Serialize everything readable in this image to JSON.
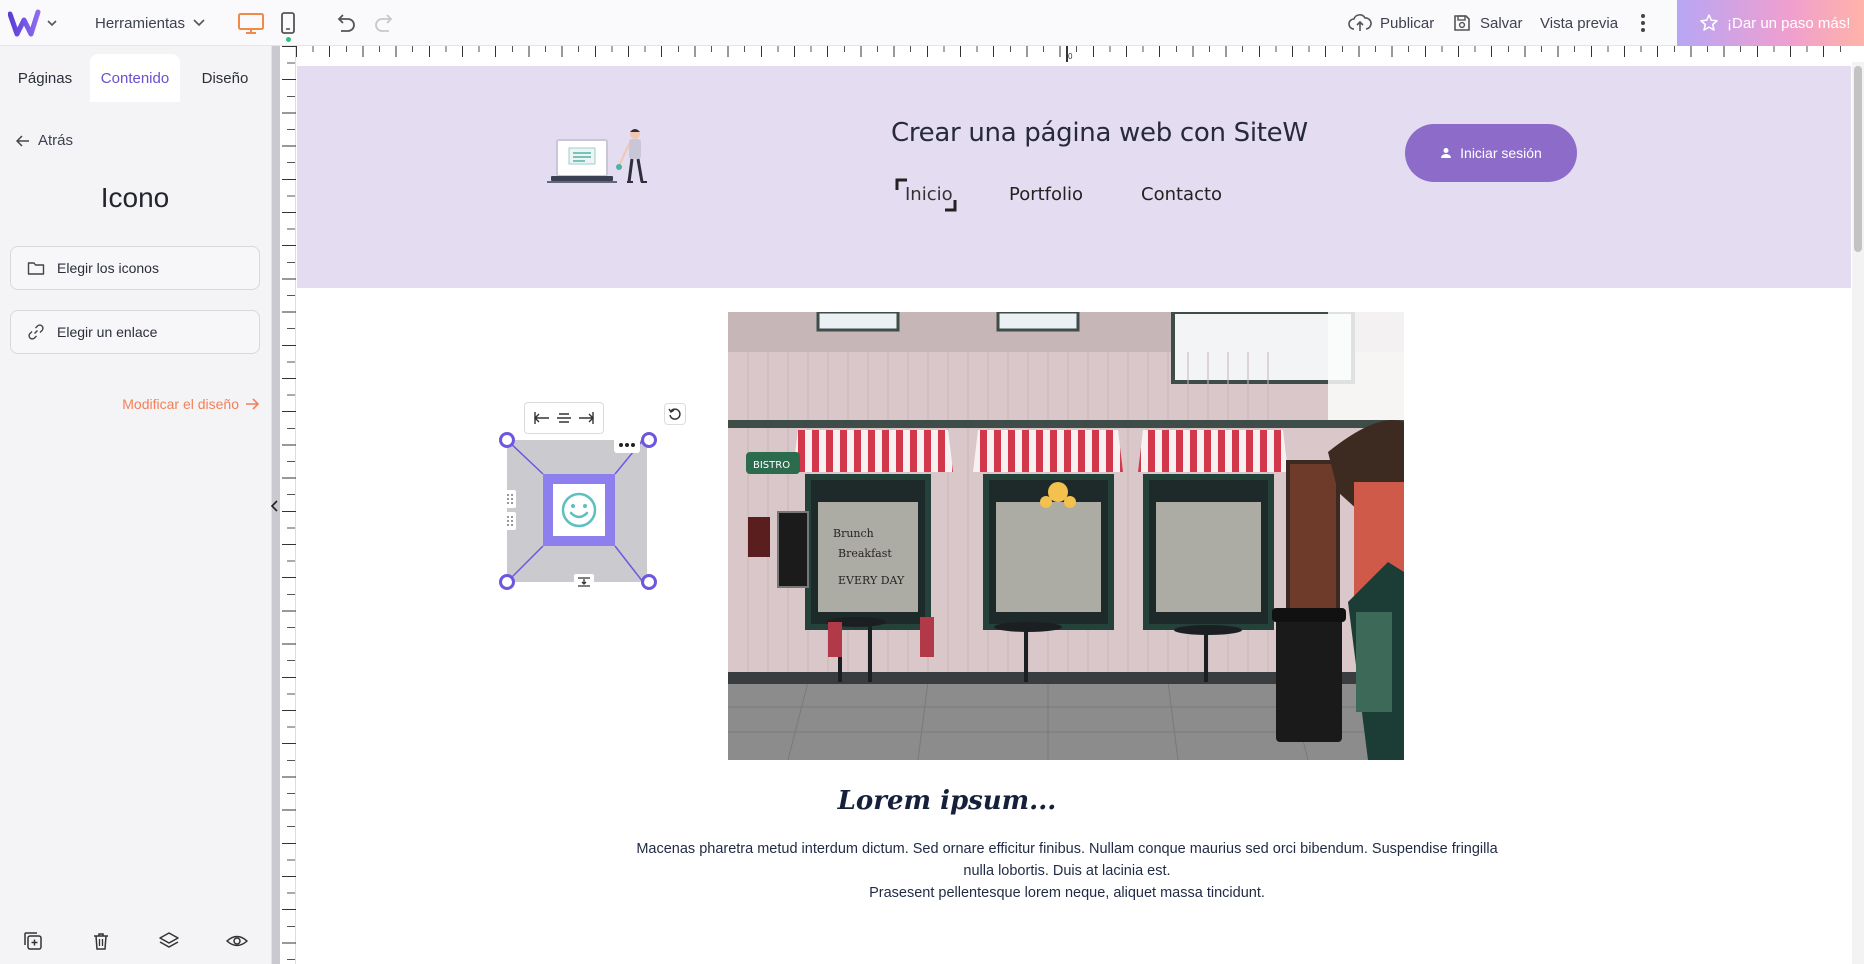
{
  "topbar": {
    "tools_label": "Herramientas",
    "publish_label": "Publicar",
    "save_label": "Salvar",
    "preview_label": "Vista previa",
    "upgrade_label": "¡Dar un paso más!",
    "accent_color": "#f08a4b"
  },
  "left_panel": {
    "tabs": [
      {
        "label": "Páginas",
        "active": false
      },
      {
        "label": "Contenido",
        "active": true
      },
      {
        "label": "Diseño",
        "active": false
      }
    ],
    "back_label": "Atrás",
    "title": "Icono",
    "choose_icons_label": "Elegir los iconos",
    "choose_link_label": "Elegir un enlace",
    "modify_design_label": "Modificar el diseño",
    "accent_color": "#6b4fd0"
  },
  "ruler": {
    "origin_label": "0"
  },
  "site": {
    "title": "Crear una página web con SiteW",
    "login_label": "Iniciar sesión",
    "nav": [
      "Inicio",
      "Portfolio",
      "Contacto"
    ],
    "header_bg": "#e4dcf0",
    "button_color": "#8d6cc9",
    "heading": "Lorem ipsum...",
    "paragraph_line1": "Macenas pharetra metud interdum dictum. Sed ornare efficitur finibus. Nullam conque maurius sed orci bibendum. Suspendise fringilla nulla lobortis. Duis at lacinia est.",
    "paragraph_line2": "Prasesent pellentesque lorem neque, aliquet massa tincidunt."
  }
}
